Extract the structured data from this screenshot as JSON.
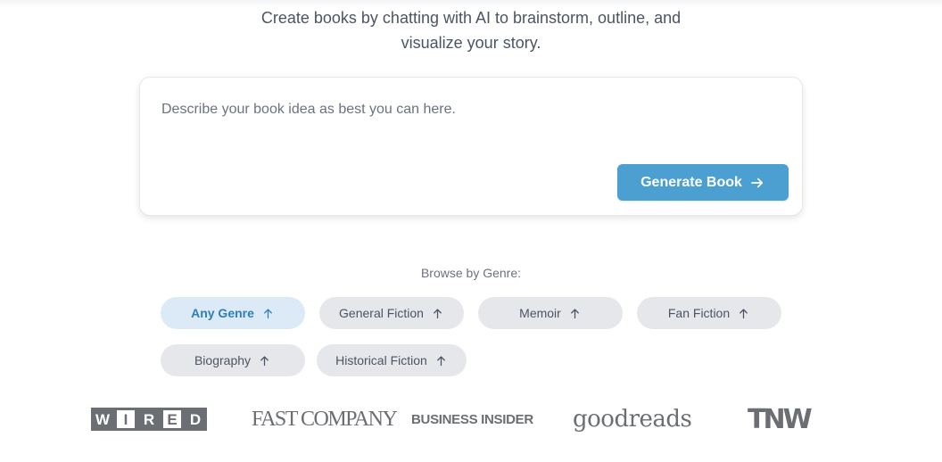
{
  "hero": {
    "subtitle_line1": "Create books by chatting with AI to brainstorm, outline, and",
    "subtitle_line2": "visualize your story."
  },
  "prompt": {
    "placeholder": "Describe your book idea as best you can here.",
    "value": "",
    "generate_label": "Generate Book",
    "generate_icon": "arrow-right-icon",
    "accent_color": "#4b9fd1"
  },
  "genres": {
    "label": "Browse by Genre:",
    "items": [
      {
        "label": "Any Genre",
        "active": true,
        "icon": "arrow-up-icon"
      },
      {
        "label": "General Fiction",
        "active": false,
        "icon": "arrow-up-icon"
      },
      {
        "label": "Memoir",
        "active": false,
        "icon": "arrow-up-icon"
      },
      {
        "label": "Fan Fiction",
        "active": false,
        "icon": "arrow-up-icon"
      },
      {
        "label": "Biography",
        "active": false,
        "icon": "arrow-up-icon"
      },
      {
        "label": "Historical Fiction",
        "active": false,
        "icon": "arrow-up-icon"
      }
    ],
    "active_bg": "#dbeaf6",
    "active_text": "#2f7eb6",
    "inactive_bg": "#e5e7eb"
  },
  "press_logos": {
    "wired": [
      "W",
      "I",
      "R",
      "E",
      "D"
    ],
    "fast_company": "FAST COMPANY",
    "business_insider": "BUSINESS INSIDER",
    "goodreads": "goodreads",
    "tnw": "TNW",
    "logo_color": "#6b6e72"
  }
}
